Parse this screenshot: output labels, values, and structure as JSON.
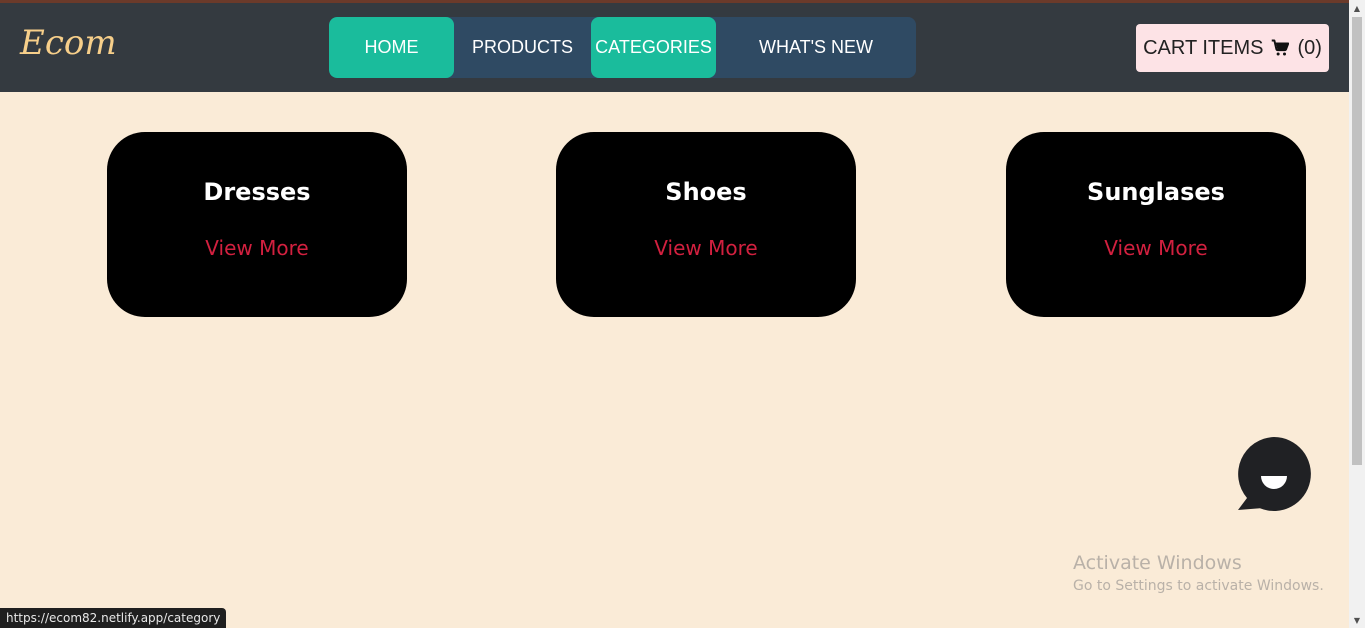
{
  "header": {
    "brand": "Ecom",
    "nav": [
      {
        "label": "HOME",
        "active": true
      },
      {
        "label": "PRODUCTS",
        "active": false
      },
      {
        "label": "CATEGORIES",
        "active": true
      },
      {
        "label": "WHAT'S NEW",
        "active": false
      }
    ],
    "cart": {
      "label": "CART ITEMS",
      "icon": "cart-icon",
      "count": "(0)"
    }
  },
  "categories": [
    {
      "title": "Dresses",
      "link": "View More"
    },
    {
      "title": "Shoes",
      "link": "View More"
    },
    {
      "title": "Sunglases",
      "link": "View More"
    }
  ],
  "chat": {
    "icon": "chat-bubble-icon"
  },
  "watermark": {
    "title": "Activate Windows",
    "subtitle": "Go to Settings to activate Windows."
  },
  "status_bar": {
    "url": "https://ecom82.netlify.app/category"
  },
  "colors": {
    "navbar": "#343a40",
    "nav_group": "#2f4a63",
    "accent": "#1abc9c",
    "page_bg": "#faebd7",
    "card_bg": "#000000",
    "link": "#d2203f",
    "cart_bg": "#fde3e6"
  }
}
